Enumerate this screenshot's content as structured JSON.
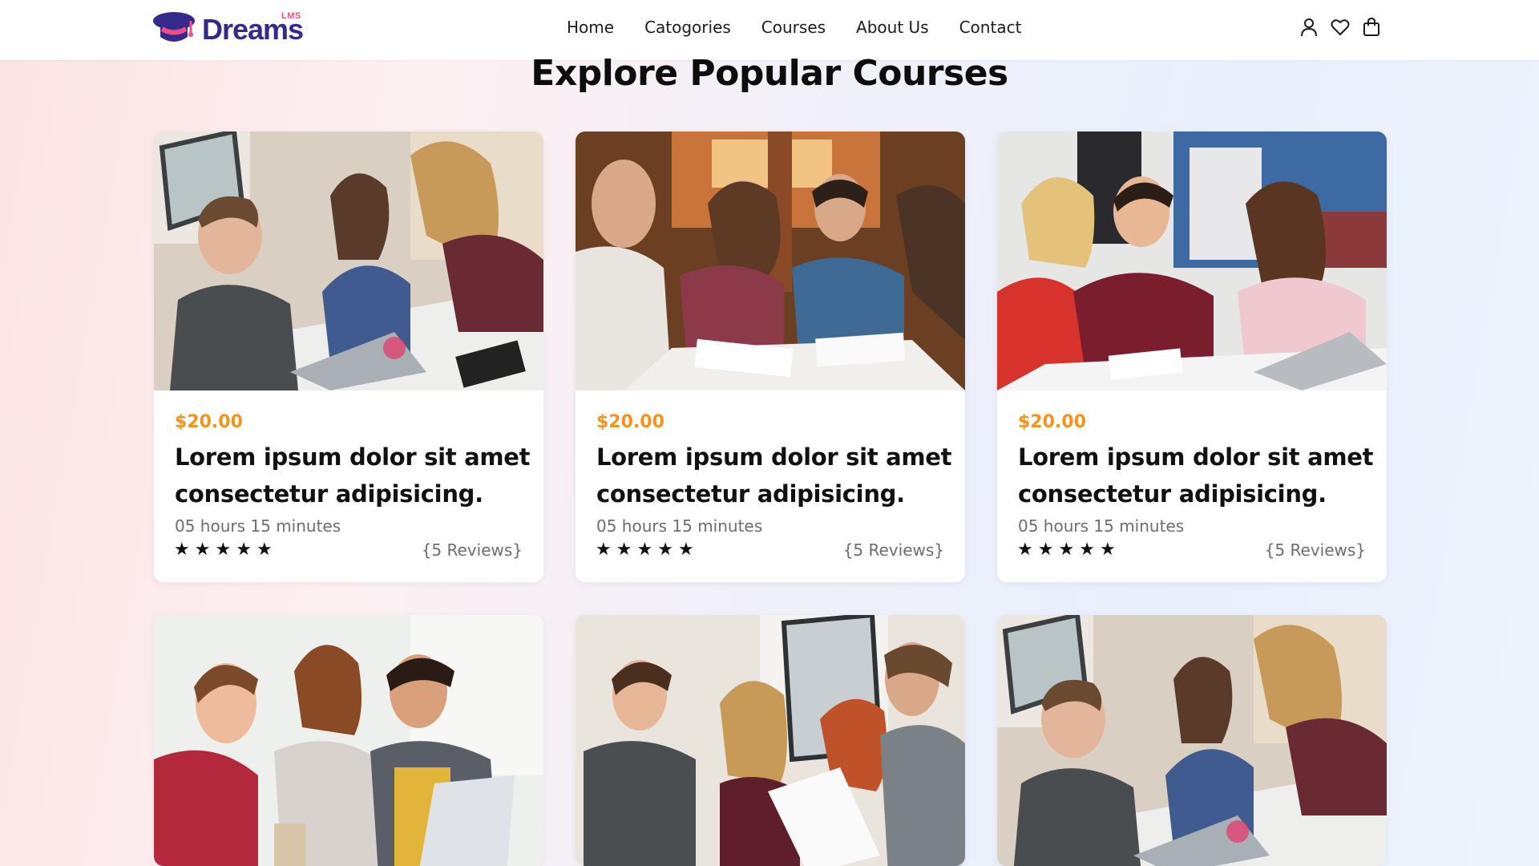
{
  "brand": {
    "name": "Dreams",
    "sup": "LMS",
    "color_primary": "#342a8c",
    "color_accent": "#ef4b86"
  },
  "nav": {
    "items": [
      {
        "label": "Home"
      },
      {
        "label": "Catogories"
      },
      {
        "label": "Courses"
      },
      {
        "label": "About Us"
      },
      {
        "label": "Contact"
      }
    ],
    "icons": [
      "user-icon",
      "heart-icon",
      "shopping-bag-icon"
    ]
  },
  "section": {
    "title": "Explore Popular Courses"
  },
  "price_color": "#f3941e",
  "courses": [
    {
      "photo": "students-studying-at-table-photo",
      "price": "$20.00",
      "title": "Lorem ipsum dolor sit amet consectetur adipisicing.",
      "duration": "05 hours 15 minutes",
      "rating": 5,
      "reviews": "{5 Reviews}"
    },
    {
      "photo": "students-group-discussion-photo",
      "price": "$20.00",
      "title": "Lorem ipsum dolor sit amet consectetur adipisicing.",
      "duration": "05 hours 15 minutes",
      "rating": 5,
      "reviews": "{5 Reviews}"
    },
    {
      "photo": "students-with-laptop-photo",
      "price": "$20.00",
      "title": "Lorem ipsum dolor sit amet consectetur adipisicing.",
      "duration": "05 hours 15 minutes",
      "rating": 5,
      "reviews": "{5 Reviews}"
    },
    {
      "photo": "students-laughing-at-laptop-photo"
    },
    {
      "photo": "students-reviewing-papers-photo"
    },
    {
      "photo": "students-studying-at-table-photo"
    }
  ]
}
